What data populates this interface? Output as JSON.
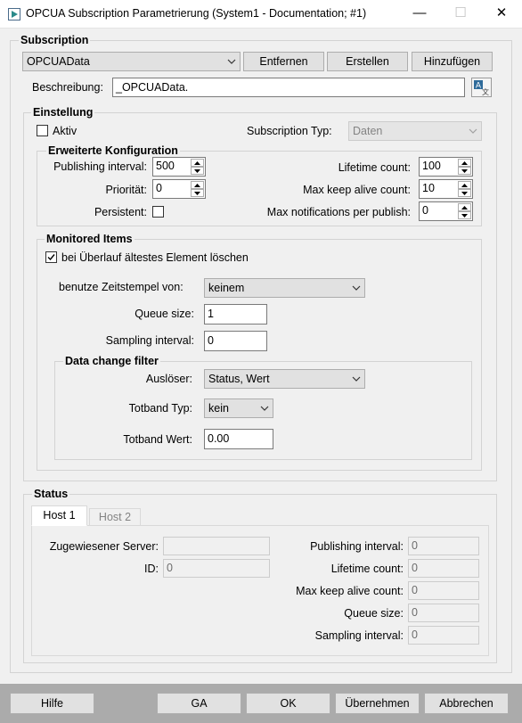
{
  "window": {
    "title": "OPCUA Subscription Parametrierung (System1 - Documentation; #1)",
    "minimize_glyph": "—",
    "maximize_glyph": "☐",
    "close_glyph": "✕"
  },
  "subscription": {
    "group_label": "Subscription",
    "selected": "OPCUAData",
    "remove_label": "Entfernen",
    "create_label": "Erstellen",
    "add_label": "Hinzufügen",
    "description_label": "Beschreibung:",
    "description_value": "_OPCUAData."
  },
  "settings": {
    "group_label": "Einstellung",
    "active_label": "Aktiv",
    "active_checked": false,
    "type_label": "Subscription Typ:",
    "type_value": "Daten"
  },
  "advanced": {
    "group_label": "Erweiterte Konfiguration",
    "publishing_interval_label": "Publishing interval:",
    "publishing_interval": "500",
    "priority_label": "Priorität:",
    "priority": "0",
    "persistent_label": "Persistent:",
    "persistent_checked": false,
    "lifetime_count_label": "Lifetime count:",
    "lifetime_count": "100",
    "max_keep_alive_label": "Max keep alive count:",
    "max_keep_alive": "10",
    "max_notifications_label": "Max notifications per publish:",
    "max_notifications": "0"
  },
  "monitored": {
    "group_label": "Monitored Items",
    "discard_oldest_label": "bei Überlauf ältestes Element löschen",
    "discard_oldest_checked": true,
    "timestamp_label": "benutze Zeitstempel von:",
    "timestamp_value": "keinem",
    "queue_size_label": "Queue size:",
    "queue_size": "1",
    "sampling_interval_label": "Sampling interval:",
    "sampling_interval": "0"
  },
  "filter": {
    "group_label": "Data change filter",
    "trigger_label": "Auslöser:",
    "trigger_value": "Status, Wert",
    "deadband_type_label": "Totband Typ:",
    "deadband_type_value": "kein",
    "deadband_value_label": "Totband Wert:",
    "deadband_value": "0.00"
  },
  "status": {
    "group_label": "Status",
    "tabs": [
      "Host 1",
      "Host 2"
    ],
    "active_tab": 0,
    "assigned_server_label": "Zugewiesener Server:",
    "assigned_server": "",
    "id_label": "ID:",
    "id": "0",
    "publishing_interval_label": "Publishing interval:",
    "publishing_interval": "0",
    "lifetime_count_label": "Lifetime count:",
    "lifetime_count": "0",
    "max_keep_alive_label": "Max keep alive count:",
    "max_keep_alive": "0",
    "queue_size_label": "Queue size:",
    "queue_size": "0",
    "sampling_interval_label": "Sampling interval:",
    "sampling_interval": "0"
  },
  "footer": {
    "help_label": "Hilfe",
    "ga_label": "GA",
    "ok_label": "OK",
    "apply_label": "Übernehmen",
    "cancel_label": "Abbrechen"
  },
  "icons": {
    "app": "opcua-app-icon",
    "translate": "translate-icon",
    "dropdown": "chevron-down-icon"
  }
}
